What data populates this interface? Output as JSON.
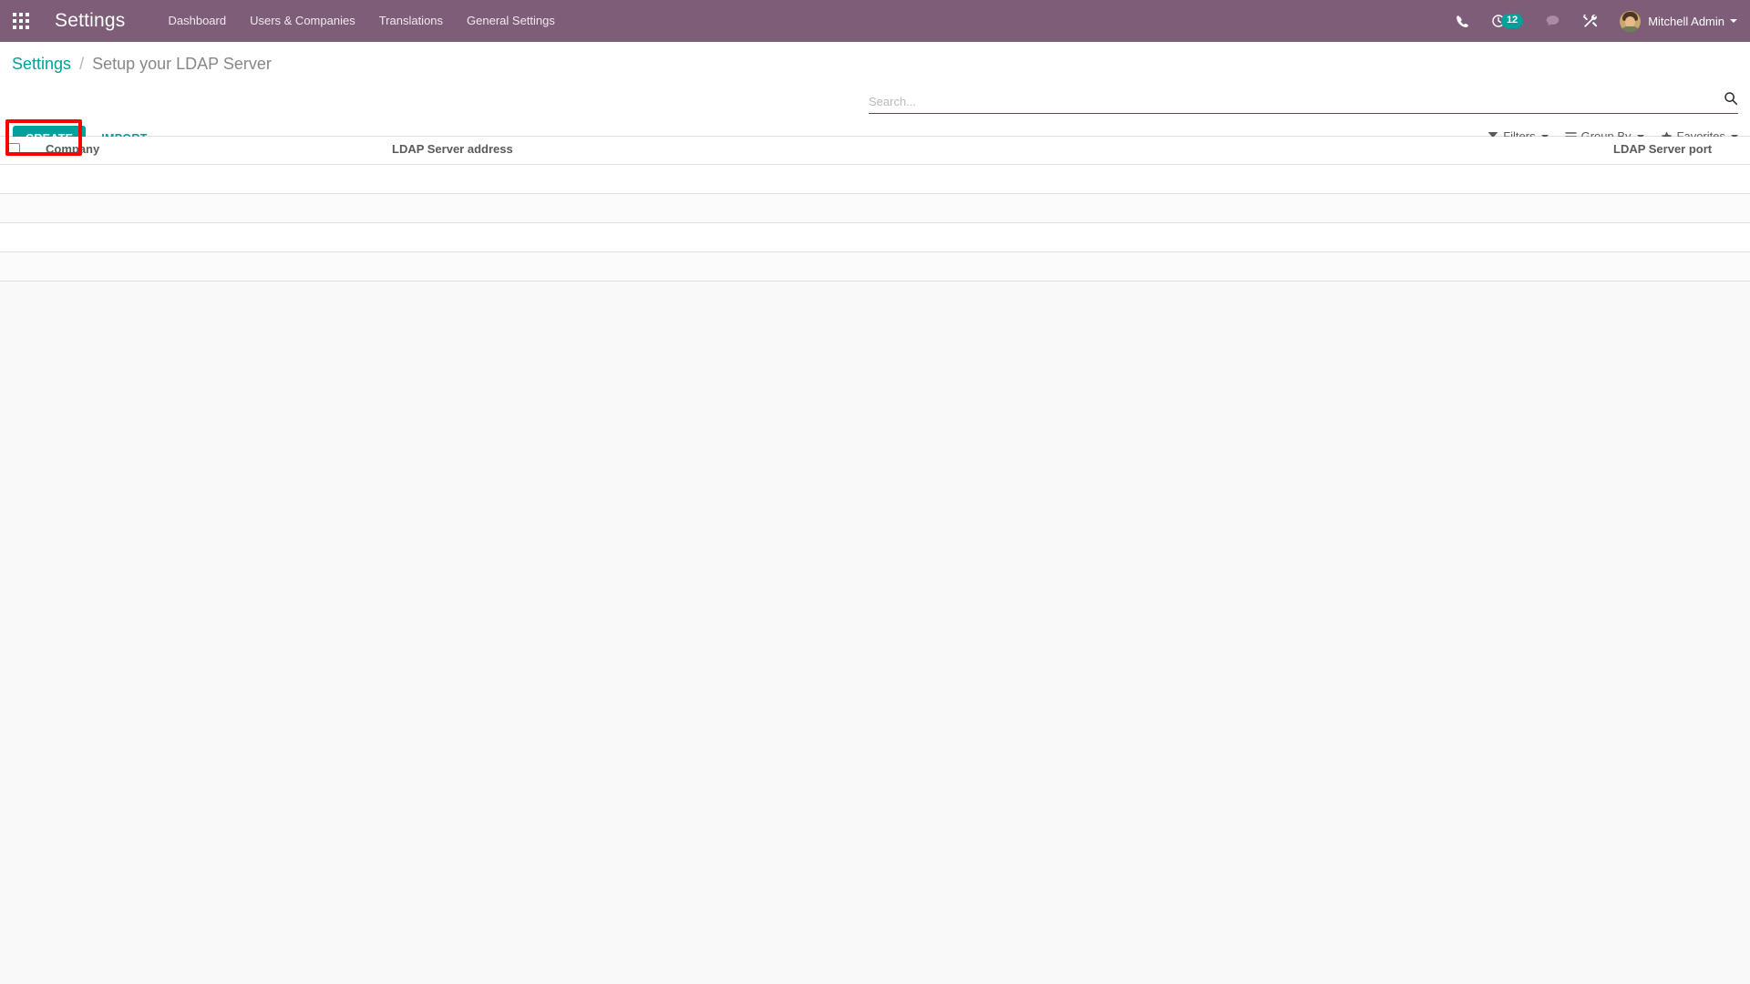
{
  "navbar": {
    "apps_icon": "apps-grid-icon",
    "brand": "Settings",
    "menu": [
      {
        "label": "Dashboard"
      },
      {
        "label": "Users & Companies"
      },
      {
        "label": "Translations"
      },
      {
        "label": "General Settings"
      }
    ],
    "right_icons": [
      {
        "name": "phone-icon"
      },
      {
        "name": "activity-clock-icon"
      },
      {
        "name": "messages-bubble-icon"
      },
      {
        "name": "developer-tools-icon"
      }
    ],
    "activity_count": "12",
    "user_name": "Mitchell Admin",
    "user_caret": "chevron-down-icon",
    "bg_color": "#7d5d77",
    "badge_color": "#00a09d"
  },
  "breadcrumb": {
    "root": "Settings",
    "separator": "/",
    "current": "Setup your LDAP Server"
  },
  "actions": {
    "create_label": "CREATE",
    "import_label": "IMPORT",
    "create_color": "#00a09d",
    "highlight_color": "#ff0000"
  },
  "search": {
    "placeholder": "Search...",
    "value": "",
    "icon": "search-icon"
  },
  "search_panel": {
    "filters_label": "Filters",
    "filters_icon": "funnel-icon",
    "groupby_label": "Group By",
    "groupby_icon": "list-lines-icon",
    "favorites_label": "Favorites",
    "favorites_icon": "star-icon"
  },
  "list": {
    "columns": [
      {
        "key": "company",
        "label": "Company",
        "align": "left"
      },
      {
        "key": "ldap_server_address",
        "label": "LDAP Server address",
        "align": "left"
      },
      {
        "key": "ldap_server_port",
        "label": "LDAP Server port",
        "align": "right"
      }
    ],
    "select_all_checkbox": "unchecked",
    "rows": [
      {
        "company": "",
        "ldap_server_address": "",
        "ldap_server_port": ""
      },
      {
        "company": "",
        "ldap_server_address": "",
        "ldap_server_port": ""
      },
      {
        "company": "",
        "ldap_server_address": "",
        "ldap_server_port": ""
      },
      {
        "company": "",
        "ldap_server_address": "",
        "ldap_server_port": ""
      }
    ]
  }
}
